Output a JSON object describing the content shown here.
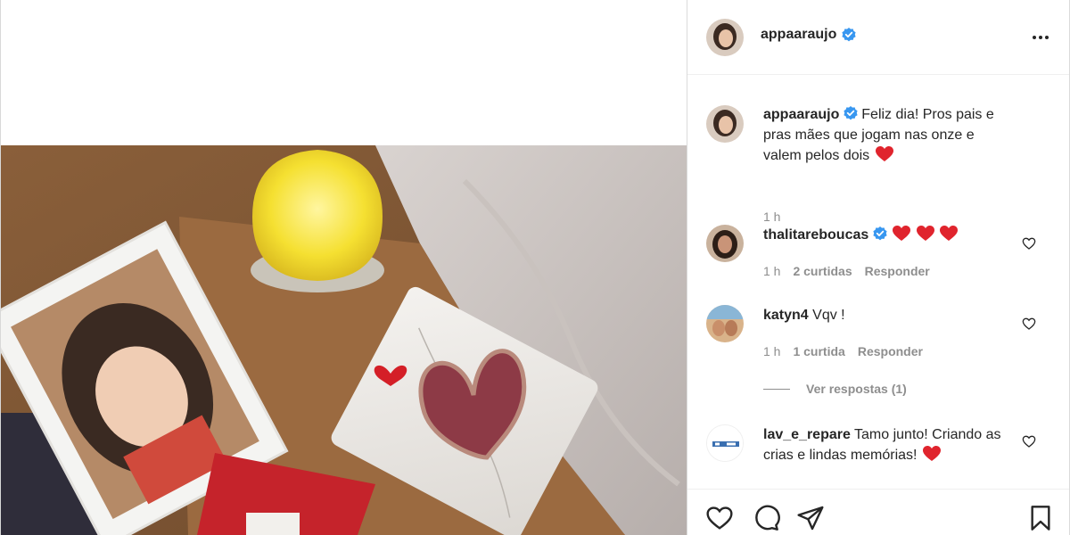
{
  "post": {
    "author": "appaaraujo",
    "verified": true
  },
  "caption": {
    "username": "appaaraujo",
    "text": "Feliz dia! Pros pais e pras mães que jogam nas onze e valem pelos dois",
    "time": "1 h"
  },
  "comments": [
    {
      "username": "thalitareboucas",
      "verified": true,
      "text": "",
      "time": "1 h",
      "likes": "2 curtidas",
      "reply": "Responder"
    },
    {
      "username": "katyn4",
      "verified": false,
      "text": "Vqv !",
      "time": "1 h",
      "likes": "1 curtida",
      "reply": "Responder",
      "view_replies": "Ver respostas (1)"
    },
    {
      "username": "lav_e_repare",
      "verified": false,
      "text": "Tamo junto! Criando as crias e lindas memórias!"
    }
  ],
  "icons": {
    "more": "more-options-icon",
    "verified": "verified-badge-icon",
    "heart_emoji": "red-heart-emoji",
    "like": "heart-outline-icon",
    "comment": "comment-icon",
    "share": "send-icon",
    "save": "bookmark-icon"
  },
  "colors": {
    "verified": "#3897f0",
    "muted": "#8e8e8e",
    "text": "#262626",
    "heart": "#e0242d"
  }
}
